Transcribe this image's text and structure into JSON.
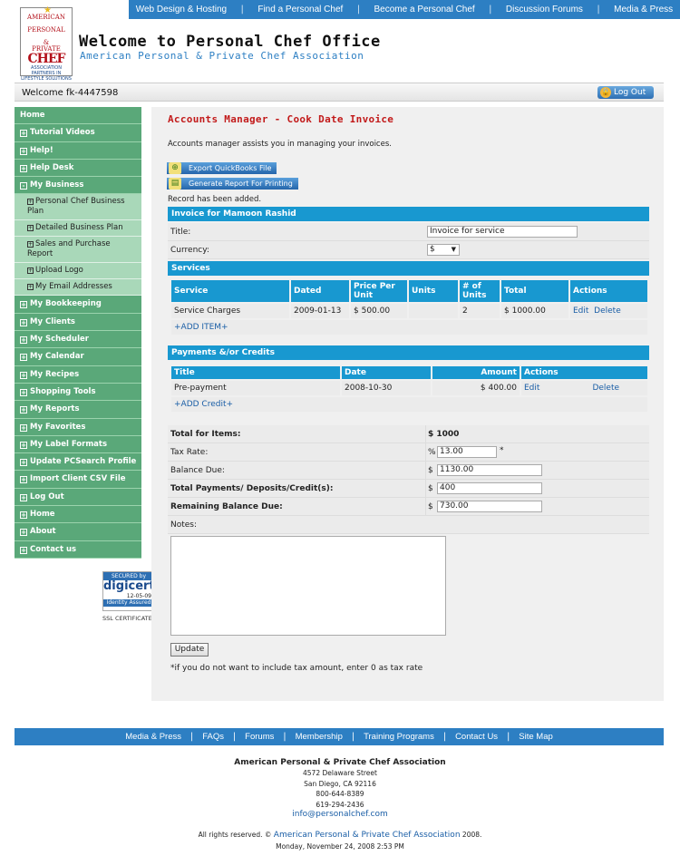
{
  "topnav": [
    "Web Design & Hosting",
    "Find a Personal Chef",
    "Become a Personal Chef",
    "Discussion Forums",
    "Media & Press"
  ],
  "logo": {
    "line1": "AMERICAN",
    "line2": "PERSONAL",
    "line3": "&",
    "line4": "PRIVATE",
    "line5": "CHEF",
    "line6": "ASSOCIATION",
    "line7": "PARTNERS IN LIFESTYLE SOLUTIONS"
  },
  "site": {
    "title": "Welcome to Personal Chef Office",
    "subtitle": "American Personal & Private Chef Association"
  },
  "welcome": "Welcome fk-4447598",
  "logout": "Log Out",
  "sidebar": [
    {
      "label": "Home",
      "box": ""
    },
    {
      "label": "Tutorial Videos",
      "box": "+"
    },
    {
      "label": "Help!",
      "box": "+"
    },
    {
      "label": "Help Desk",
      "box": "+"
    },
    {
      "label": "My Business",
      "box": "-"
    }
  ],
  "sidebar_sub": [
    "Personal Chef Business Plan",
    "Detailed Business Plan",
    "Sales and Purchase Report",
    "Upload Logo",
    "My Email Addresses"
  ],
  "sidebar2": [
    {
      "label": "My Bookkeeping",
      "box": "+"
    },
    {
      "label": "My Clients",
      "box": "+"
    },
    {
      "label": "My Scheduler",
      "box": "+"
    },
    {
      "label": "My Calendar",
      "box": "+"
    },
    {
      "label": "My Recipes",
      "box": "+"
    },
    {
      "label": "Shopping Tools",
      "box": "+"
    },
    {
      "label": "My Reports",
      "box": "+"
    },
    {
      "label": "My Favorites",
      "box": "+"
    },
    {
      "label": "My Label Formats",
      "box": "+"
    },
    {
      "label": "Update PCSearch Profile",
      "box": "+"
    },
    {
      "label": "Import Client CSV File",
      "box": "+"
    },
    {
      "label": "Log Out",
      "box": "+"
    },
    {
      "label": "Home",
      "box": "+"
    },
    {
      "label": "About",
      "box": "+"
    },
    {
      "label": "Contact us",
      "box": "+"
    }
  ],
  "ssl": {
    "top": "SECURED by",
    "brand": "digicert",
    "date": "12-05-09",
    "assured": "Identity Assured",
    "label": "SSL CERTIFICATE"
  },
  "main": {
    "title": "Accounts Manager - Cook Date Invoice",
    "desc": "Accounts manager assists you in managing your invoices.",
    "export_btn": "Export QuickBooks File",
    "report_btn": "Generate Report For Printing",
    "record_msg": "Record has been added.",
    "invoice_header": "Invoice for Mamoon Rashid",
    "title_label": "Title:",
    "title_value": "Invoice for service",
    "currency_label": "Currency:",
    "currency_value": "$",
    "services_header": "Services",
    "services_cols": [
      "Service",
      "Dated",
      "Price Per Unit",
      "Units",
      "# of Units",
      "Total",
      "Actions"
    ],
    "services_row": {
      "service": "Service Charges",
      "dated": "2009-01-13",
      "price": "$ 500.00",
      "units": "",
      "num": "2",
      "total": "$ 1000.00",
      "edit": "Edit",
      "delete": "Delete"
    },
    "add_item": "+ADD ITEM+",
    "payments_header": "Payments &/or Credits",
    "payments_cols": [
      "Title",
      "Date",
      "Amount",
      "Actions"
    ],
    "payments_row": {
      "title": "Pre-payment",
      "date": "2008-10-30",
      "amount": "$ 400.00",
      "edit": "Edit",
      "delete": "Delete"
    },
    "add_credit": "+ADD Credit+",
    "total_label": "Total for Items:",
    "total_value": "$ 1000",
    "tax_label": "Tax Rate:",
    "tax_prefix": "%",
    "tax_value": "13.00",
    "tax_suffix": "*",
    "balance_label": "Balance Due:",
    "balance_value": "1130.00",
    "payments_label": "Total Payments/ Deposits/Credit(s):",
    "payments_value": "400",
    "remaining_label": "Remaining Balance Due:",
    "remaining_value": "730.00",
    "currency_symbol": "$",
    "notes_label": "Notes:",
    "update_btn": "Update",
    "hint": "*if you do not want to include tax amount, enter 0 as tax rate"
  },
  "botnav": [
    "Media & Press",
    "FAQs",
    "Forums",
    "Membership",
    "Training Programs",
    "Contact Us",
    "Site Map"
  ],
  "footer": {
    "org": "American Personal & Private Chef Association",
    "addr1": "4572 Delaware Street",
    "addr2": "San Diego, CA 92116",
    "phone1": "800-644-8389",
    "phone2": "619-294-2436",
    "email": "info@personalchef.com",
    "rights_pre": "All rights reserved. ©",
    "rights_link": "American Personal & Private Chef Association",
    "rights_year": "2008.",
    "timestamp": "Monday, November 24, 2008 2:53 PM"
  }
}
